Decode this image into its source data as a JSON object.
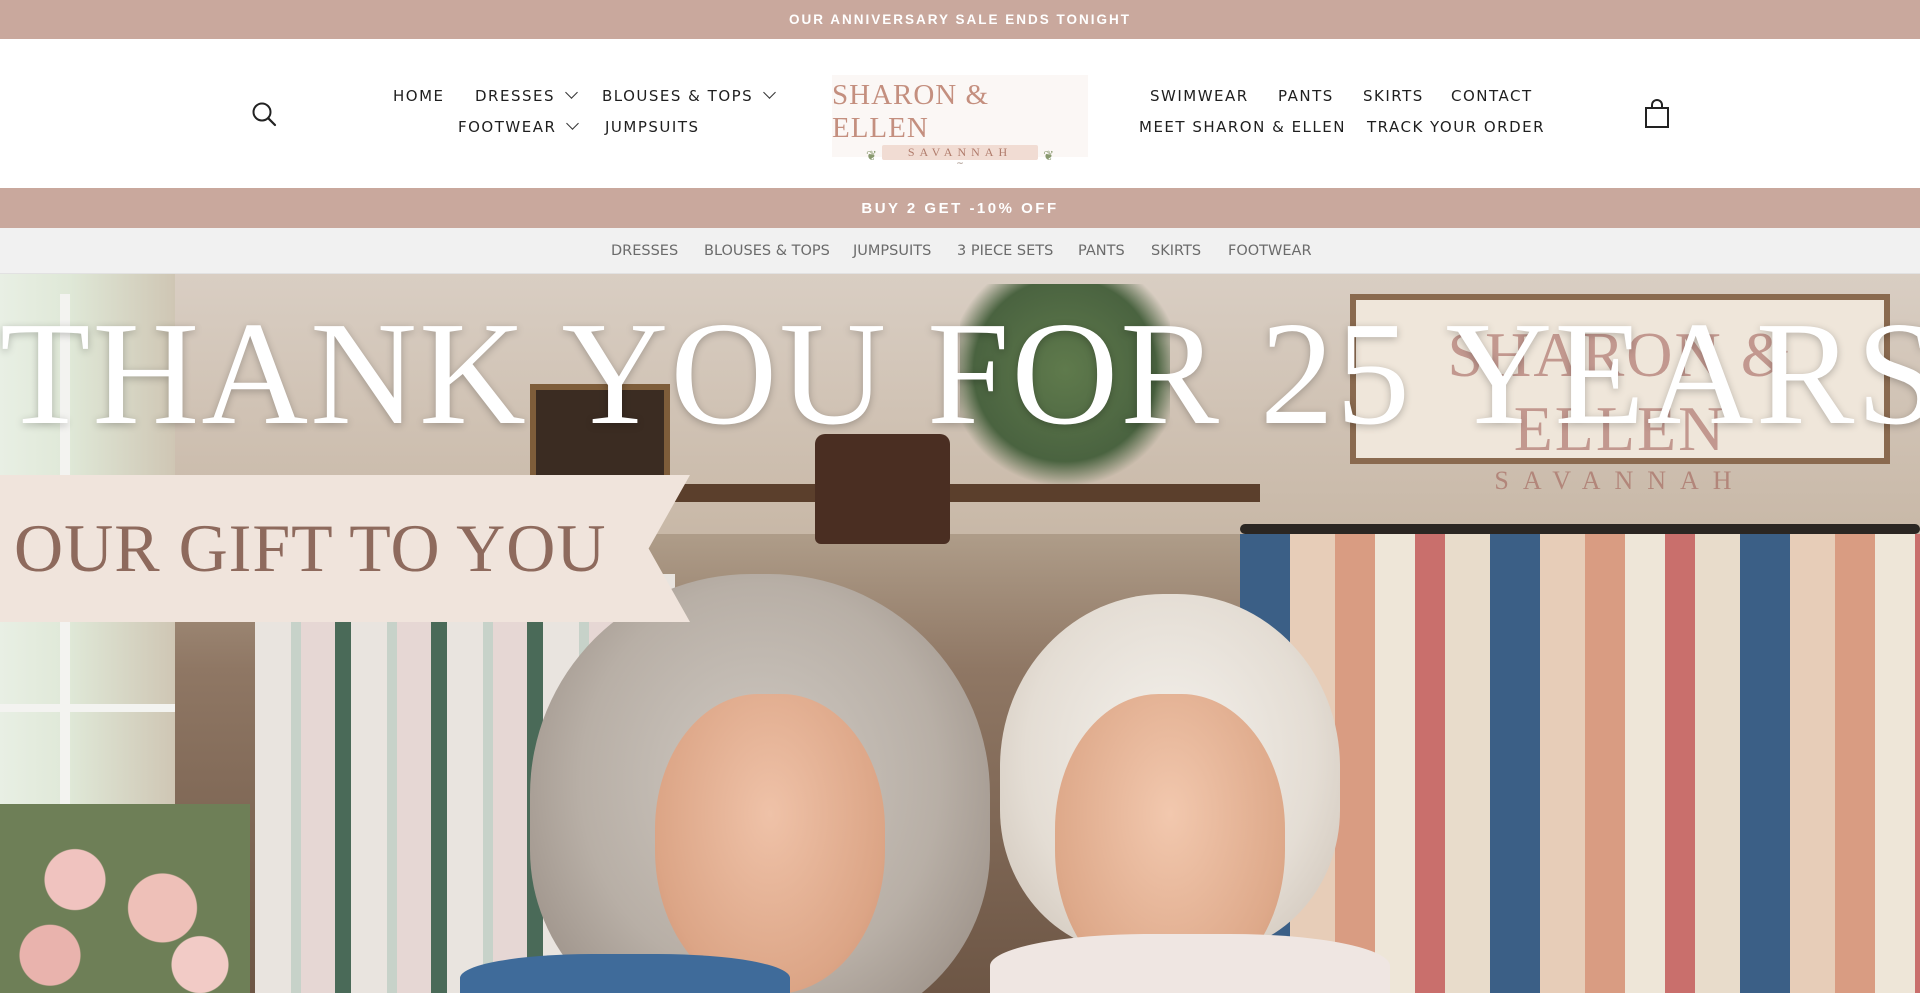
{
  "announcement": {
    "text": "OUR ANNIVERSARY SALE ENDS TONIGHT"
  },
  "header": {
    "search_icon": "search-icon",
    "cart_icon": "shopping-bag-icon",
    "nav_left": {
      "home": "HOME",
      "dresses": "DRESSES",
      "blouses_tops": "BLOUSES & TOPS",
      "footwear": "FOOTWEAR",
      "jumpsuits": "JUMPSUITS"
    },
    "nav_right": {
      "swimwear": "SWIMWEAR",
      "pants": "PANTS",
      "skirts": "SKIRTS",
      "contact": "CONTACT",
      "meet": "MEET SHARON & ELLEN",
      "track": "TRACK YOUR ORDER"
    },
    "logo": {
      "title": "SHARON & ELLEN",
      "subtitle": "SAVANNAH"
    }
  },
  "promo": {
    "text": "BUY 2 GET -10% OFF"
  },
  "category_bar": {
    "items": [
      "DRESSES",
      "BLOUSES & TOPS",
      "JUMPSUITS",
      "3 PIECE SETS",
      "PANTS",
      "SKIRTS",
      "FOOTWEAR"
    ]
  },
  "hero": {
    "title": "THANK YOU FOR 25 YEARS",
    "banner": "OUR GIFT TO YOU",
    "sign_text": "SHARON & ELLEN",
    "sign_subtext": "SAVANNAH"
  },
  "colors": {
    "accent": "#c9a89d",
    "logo": "#c48f7f",
    "banner": "#f0e4dc",
    "banner_text": "#8e6a5d"
  }
}
